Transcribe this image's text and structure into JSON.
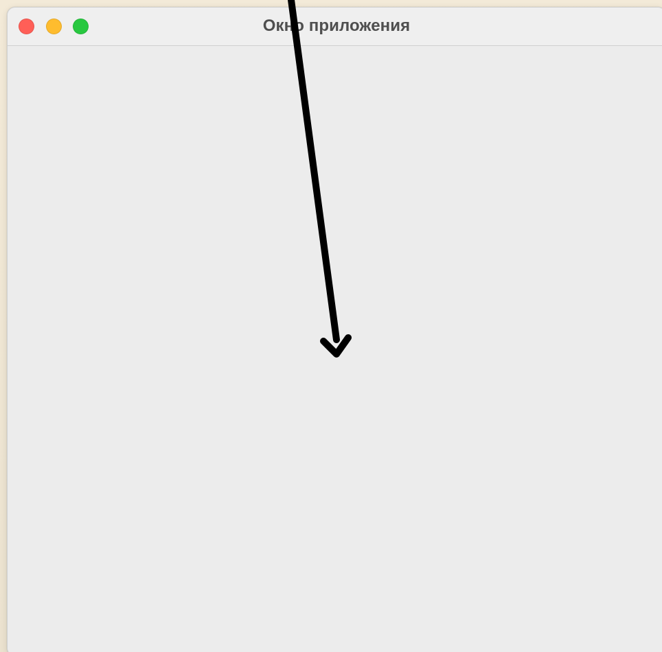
{
  "window": {
    "title": "Окно приложения"
  },
  "controls": {
    "close": "close",
    "minimize": "minimize",
    "zoom": "zoom"
  },
  "colors": {
    "desktop": "#efe6d3",
    "titlebar": "#efefef",
    "content": "#ececec",
    "close": "#ff5f57",
    "minimize": "#febc2e",
    "zoom": "#28c840",
    "arrow": "#000000",
    "title_text": "#4f4f4f"
  },
  "icons": {
    "close": "close-circle-icon",
    "minimize": "minimize-circle-icon",
    "zoom": "zoom-circle-icon",
    "arrow": "down-arrow-annotation"
  }
}
